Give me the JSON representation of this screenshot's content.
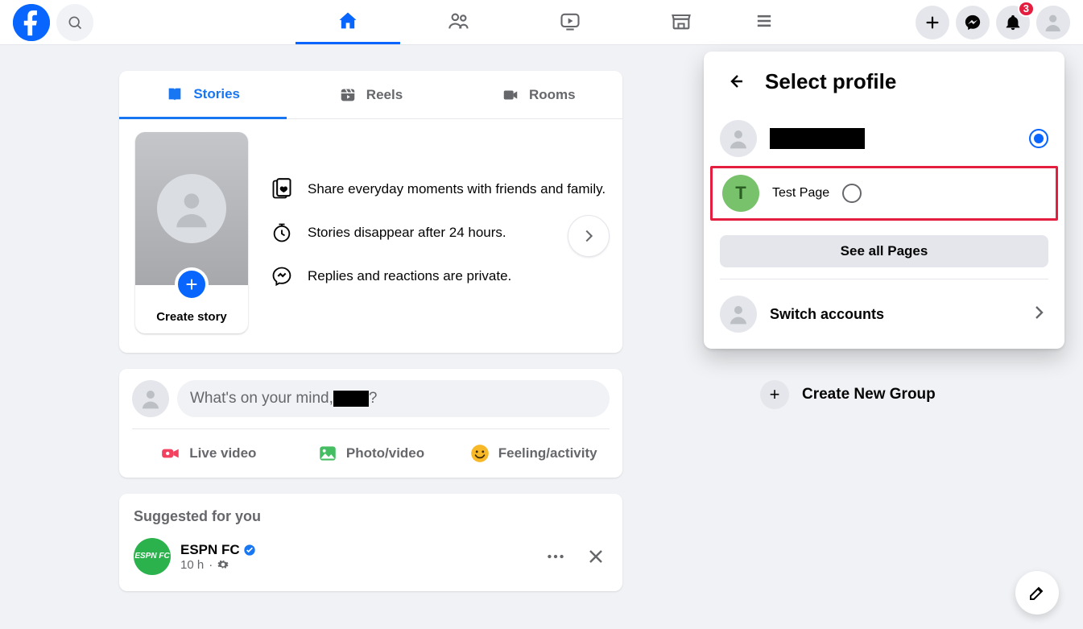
{
  "header": {
    "notifications_count": "3"
  },
  "stories": {
    "tabs": {
      "stories": "Stories",
      "reels": "Reels",
      "rooms": "Rooms"
    },
    "create_label": "Create story",
    "info1": "Share everyday moments with friends and family.",
    "info2": "Stories disappear after 24 hours.",
    "info3": "Replies and reactions are private."
  },
  "composer": {
    "prefix": "What's on your mind, ",
    "suffix": "?",
    "live": "Live video",
    "photo": "Photo/video",
    "feeling": "Feeling/activity"
  },
  "suggested": {
    "heading": "Suggested for you",
    "post_title": "ESPN FC",
    "post_logo": "ESPN FC",
    "post_time": "10 h"
  },
  "right_col": {
    "create_group": "Create New Group"
  },
  "popover": {
    "title": "Select profile",
    "test_page_initial": "T",
    "test_page": "Test Page",
    "see_all": "See all Pages",
    "switch": "Switch accounts"
  }
}
